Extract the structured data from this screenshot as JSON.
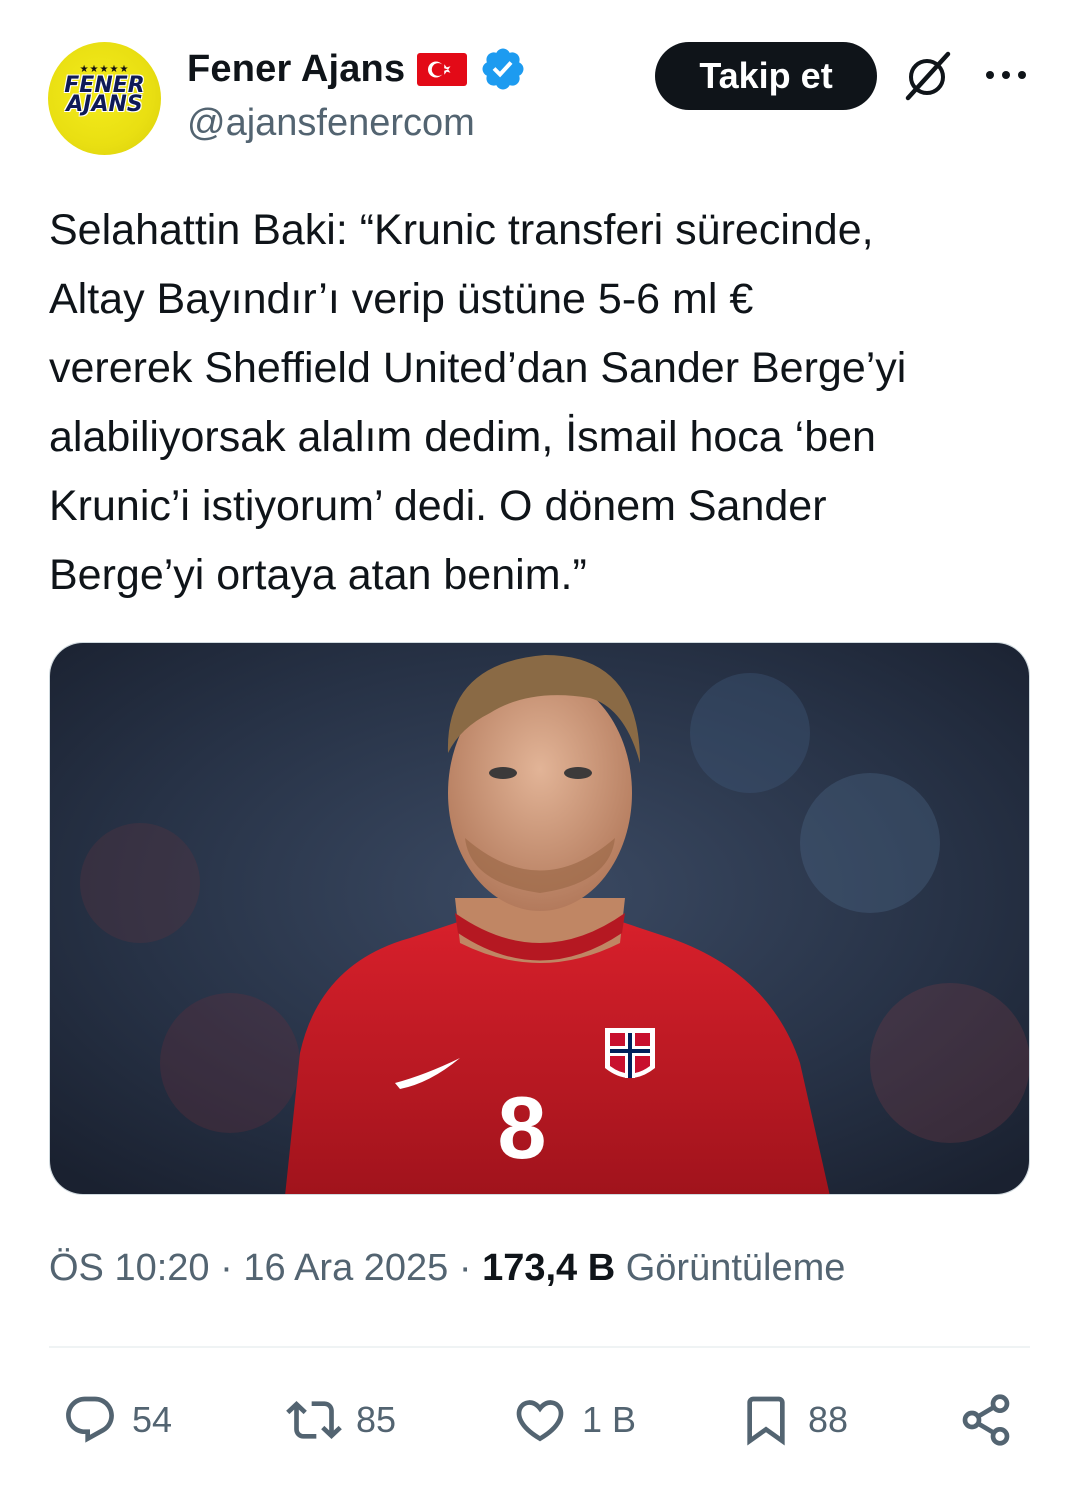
{
  "account": {
    "display_name": "Fener Ajans",
    "handle": "@ajansfenercom",
    "avatar_text": "FENER AJANS",
    "verified": true
  },
  "follow_button": {
    "label": "Takip et"
  },
  "tweet": {
    "text": "Selahattin Baki: “Krunic transferi sürecinde,\nAltay Bayındır’ı verip üstüne 5-6 ml €\nvererek Sheffield United’dan Sander Berge’yi\nalabiliyorsak alalım dedim, İsmail hoca ‘ben\nKrunic’i istiyorum’ dedi. O dönem Sander\nBerge’yi  ortaya atan benim.”",
    "media": {
      "jersey_number": "8"
    }
  },
  "meta": {
    "time": "ÖS 10:20",
    "separator": " · ",
    "date": "16 Ara 2025",
    "views_count": "173,4 B",
    "views_label": " Görüntüleme"
  },
  "actions": {
    "replies": "54",
    "reposts": "85",
    "likes": "1 B",
    "bookmarks": "88"
  },
  "colors": {
    "accent_blue": "#1d9bf0",
    "text_primary": "#0f1419",
    "text_secondary": "#536471",
    "button_dark": "#0f1419"
  }
}
